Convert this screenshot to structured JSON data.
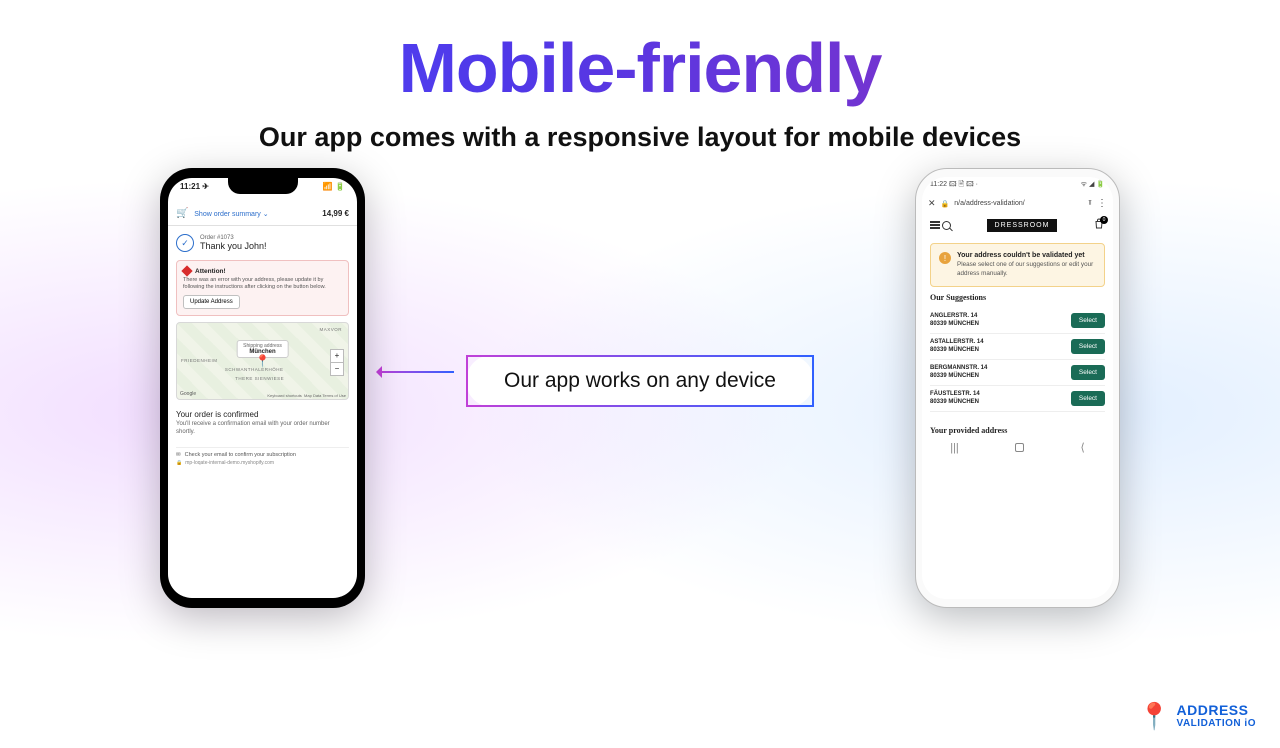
{
  "title": "Mobile-friendly",
  "subtitle": "Our app comes with a responsive layout for mobile devices",
  "pill": "Our app works on any device",
  "logo": {
    "line1": "ADDRESS",
    "line2": "VALIDATION iO"
  },
  "ios": {
    "time": "11:21 ✈",
    "signal": "􀙇 􀛨",
    "summary_link": "Show order summary ⌄",
    "price": "14,99 €",
    "order_num": "Order #1073",
    "thanks": "Thank you John!",
    "alert_title": "Attention!",
    "alert_msg": "There was an error with your address, please update it by following the instructions after clicking on the button below.",
    "update_btn": "Update Address",
    "map_chip_title": "Shipping address",
    "map_chip_loc": "München",
    "map_area1": "MAXVOR",
    "map_area2": "FRIEDENHEIM",
    "map_area3": "SCHWANTHALERHÖHE",
    "map_area4": "THERE SIENWIESE",
    "map_kbd": "Keyboard shortcuts",
    "map_terms": "Map Data   Terms of Use",
    "map_google": "Google",
    "conf_title": "Your order is confirmed",
    "conf_msg": "You'll receive a confirmation email with your order number shortly.",
    "sub_msg": "Check your email to confirm your subscription",
    "domain": "mp-loqate-internal-demo.myshopify.com"
  },
  "android": {
    "time": "11:22 🖾 🖹 🖾 ·",
    "sys": "ᯤ ◢ 🔋",
    "url": "n/a/address-validation/",
    "brand": "DRESSROOM",
    "bag_count": "0",
    "warn_title": "Your address couldn't be validated yet",
    "warn_msg": "Please select one of our suggestions or edit your address manually.",
    "sugg_title": "Our Suggestions",
    "select_label": "Select",
    "suggestions": [
      {
        "l1": "ANGLERSTR. 14",
        "l2": "80339 MÜNCHEN"
      },
      {
        "l1": "ASTALLERSTR. 14",
        "l2": "80339 MÜNCHEN"
      },
      {
        "l1": "BERGMANNSTR. 14",
        "l2": "80339 MÜNCHEN"
      },
      {
        "l1": "FÄUSTLESTR. 14",
        "l2": "80339 MÜNCHEN"
      }
    ],
    "provided_title": "Your provided address"
  }
}
